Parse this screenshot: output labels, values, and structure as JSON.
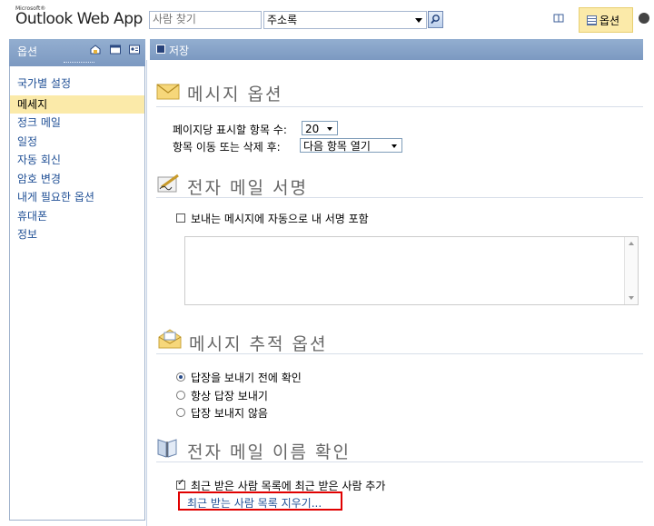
{
  "header": {
    "brand_small": "Microsoft®",
    "brand": "Outlook Web App",
    "search_placeholder": "사람 찾기",
    "address_book_select": "주소록",
    "options_label": "옵션"
  },
  "sidebar": {
    "title": "옵션",
    "items": [
      {
        "label": "국가별 설정",
        "selected": false
      },
      {
        "label": "메세지",
        "selected": true
      },
      {
        "label": "정크 메일",
        "selected": false
      },
      {
        "label": "일정",
        "selected": false
      },
      {
        "label": "자동 회신",
        "selected": false
      },
      {
        "label": "암호 변경",
        "selected": false
      },
      {
        "label": "내게 필요한 옵션",
        "selected": false
      },
      {
        "label": "휴대폰",
        "selected": false
      },
      {
        "label": "정보",
        "selected": false
      }
    ]
  },
  "toolbar": {
    "save_label": "저장"
  },
  "sections": {
    "message_options": {
      "title": "메시지 옵션",
      "items_per_page_label": "페이지당 표시할 항목 수:",
      "items_per_page_value": "20",
      "after_move_label": "항목 이동 또는 삭제 후:",
      "after_move_value": "다음 항목 열기"
    },
    "signature": {
      "title": "전자 메일 서명",
      "auto_include_label": "보내는 메시지에 자동으로 내 서명 포함",
      "auto_include_checked": false
    },
    "tracking": {
      "title": "메시지 추적 옵션",
      "options": [
        {
          "label": "답장을 보내기 전에 확인",
          "checked": true
        },
        {
          "label": "항상 답장 보내기",
          "checked": false
        },
        {
          "label": "답장 보내지 않음",
          "checked": false
        }
      ]
    },
    "name_check": {
      "title": "전자 메일 이름 확인",
      "add_recent_label": "최근 받은 사람 목록에 최근 받은 사람 추가",
      "add_recent_checked": true,
      "clear_recent_link": "최근 받는 사람 목록 지우기..."
    }
  },
  "colors": {
    "header_blue": "#7c99c1",
    "selected_bg": "#fbeaa9",
    "link_blue": "#1f4f95",
    "highlight_red": "#e00000"
  }
}
